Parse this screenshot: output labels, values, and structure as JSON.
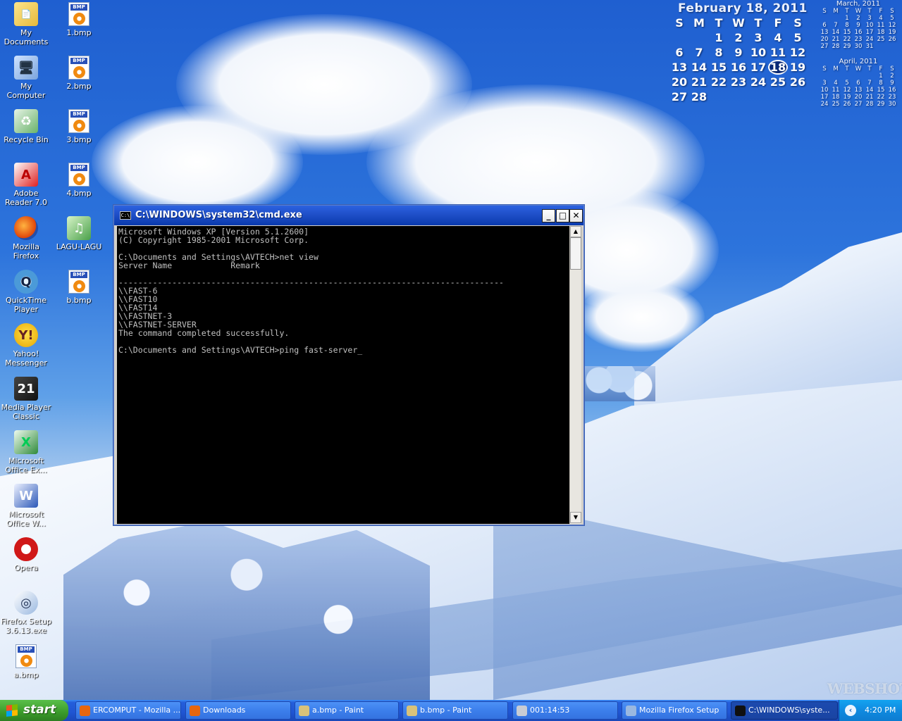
{
  "desktop_icons_left": [
    {
      "label": "My Documents",
      "icon": "my-documents-icon",
      "glyph": "📄"
    },
    {
      "label": "My Computer",
      "icon": "my-computer-icon",
      "glyph": "🖥"
    },
    {
      "label": "Recycle Bin",
      "icon": "recycle-bin-icon",
      "glyph": "♻"
    },
    {
      "label": "Adobe Reader 7.0",
      "icon": "adobe-reader-icon",
      "glyph": "A"
    },
    {
      "label": "Mozilla Firefox",
      "icon": "firefox-icon",
      "glyph": ""
    },
    {
      "label": "QuickTime Player",
      "icon": "quicktime-icon",
      "glyph": "Q"
    },
    {
      "label": "Yahoo! Messenger",
      "icon": "yahoo-messenger-icon",
      "glyph": "Y!"
    },
    {
      "label": "Media Player Classic",
      "icon": "media-player-classic-icon",
      "glyph": "21"
    },
    {
      "label": "Microsoft Office Ex...",
      "icon": "excel-icon",
      "glyph": "X"
    },
    {
      "label": "Microsoft Office W...",
      "icon": "word-icon",
      "glyph": "W"
    },
    {
      "label": "Opera",
      "icon": "opera-icon",
      "glyph": ""
    },
    {
      "label": "Firefox Setup 3.6.13.exe",
      "icon": "firefox-setup-icon",
      "glyph": "◎"
    },
    {
      "label": "a.bmp",
      "icon": "bmp-file-icon",
      "glyph": "BMP"
    }
  ],
  "desktop_icons_right": [
    {
      "label": "1.bmp",
      "icon": "bmp-file-icon",
      "glyph": "BMP"
    },
    {
      "label": "2.bmp",
      "icon": "bmp-file-icon",
      "glyph": "BMP"
    },
    {
      "label": "3.bmp",
      "icon": "bmp-file-icon",
      "glyph": "BMP"
    },
    {
      "label": "4.bmp",
      "icon": "bmp-file-icon",
      "glyph": "BMP"
    },
    {
      "label": "LAGU-LAGU",
      "icon": "lagu-lagu-icon",
      "glyph": "♫"
    },
    {
      "label": "b.bmp",
      "icon": "bmp-file-icon",
      "glyph": "BMP"
    }
  ],
  "calendar": {
    "title": "February 18, 2011",
    "weekdays": [
      "S",
      "M",
      "T",
      "W",
      "T",
      "F",
      "S"
    ],
    "days": [
      "",
      "",
      "1",
      "2",
      "3",
      "4",
      "5",
      "6",
      "7",
      "8",
      "9",
      "10",
      "11",
      "12",
      "13",
      "14",
      "15",
      "16",
      "17",
      "18",
      "19",
      "20",
      "21",
      "22",
      "23",
      "24",
      "25",
      "26",
      "27",
      "28",
      "",
      "",
      "",
      "",
      ""
    ],
    "today": "18",
    "mini_months": [
      {
        "title": "March, 2011",
        "weekdays": [
          "S",
          "M",
          "T",
          "W",
          "T",
          "F",
          "S"
        ],
        "days": [
          "",
          "",
          "1",
          "2",
          "3",
          "4",
          "5",
          "6",
          "7",
          "8",
          "9",
          "10",
          "11",
          "12",
          "13",
          "14",
          "15",
          "16",
          "17",
          "18",
          "19",
          "20",
          "21",
          "22",
          "23",
          "24",
          "25",
          "26",
          "27",
          "28",
          "29",
          "30",
          "31",
          "",
          ""
        ]
      },
      {
        "title": "April, 2011",
        "weekdays": [
          "S",
          "M",
          "T",
          "W",
          "T",
          "F",
          "S"
        ],
        "days": [
          "",
          "",
          "",
          "",
          "",
          "1",
          "2",
          "3",
          "4",
          "5",
          "6",
          "7",
          "8",
          "9",
          "10",
          "11",
          "12",
          "13",
          "14",
          "15",
          "16",
          "17",
          "18",
          "19",
          "20",
          "21",
          "22",
          "23",
          "24",
          "25",
          "26",
          "27",
          "28",
          "29",
          "30"
        ]
      }
    ]
  },
  "cmd_window": {
    "title": "C:\\WINDOWS\\system32\\cmd.exe",
    "icon_text": "C:\\",
    "minimize": "_",
    "maximize": "□",
    "close": "✕",
    "lines": [
      "Microsoft Windows XP [Version 5.1.2600]",
      "(C) Copyright 1985-2001 Microsoft Corp.",
      "",
      "C:\\Documents and Settings\\AVTECH>net view",
      "Server Name            Remark",
      "",
      "-------------------------------------------------------------------------------",
      "\\\\FAST-6",
      "\\\\FAST10",
      "\\\\FAST14",
      "\\\\FASTNET-3",
      "\\\\FASTNET-SERVER",
      "The command completed successfully.",
      "",
      "C:\\Documents and Settings\\AVTECH>ping fast-server_"
    ],
    "scroll_up": "▲",
    "scroll_down": "▼"
  },
  "taskbar": {
    "start_label": "start",
    "tasks": [
      {
        "label": "ERCOMPUT - Mozilla ...",
        "icon": "firefox-icon",
        "color": "#e8660e",
        "active": false
      },
      {
        "label": "Downloads",
        "icon": "firefox-icon",
        "color": "#e8660e",
        "active": false
      },
      {
        "label": "a.bmp - Paint",
        "icon": "paint-icon",
        "color": "#d9c27a",
        "active": false
      },
      {
        "label": "b.bmp - Paint",
        "icon": "paint-icon",
        "color": "#d9c27a",
        "active": false
      },
      {
        "label": "001:14:53",
        "icon": "network-icon",
        "color": "#c8ccd4",
        "active": false
      },
      {
        "label": "Mozilla Firefox Setup",
        "icon": "setup-icon",
        "color": "#9ab8e0",
        "active": false
      },
      {
        "label": "C:\\WINDOWS\\syste...",
        "icon": "cmd-icon",
        "color": "#101010",
        "active": true
      }
    ],
    "tray_arrow": "‹",
    "clock": "4:20 PM"
  },
  "watermark": "WEBSHOTS"
}
